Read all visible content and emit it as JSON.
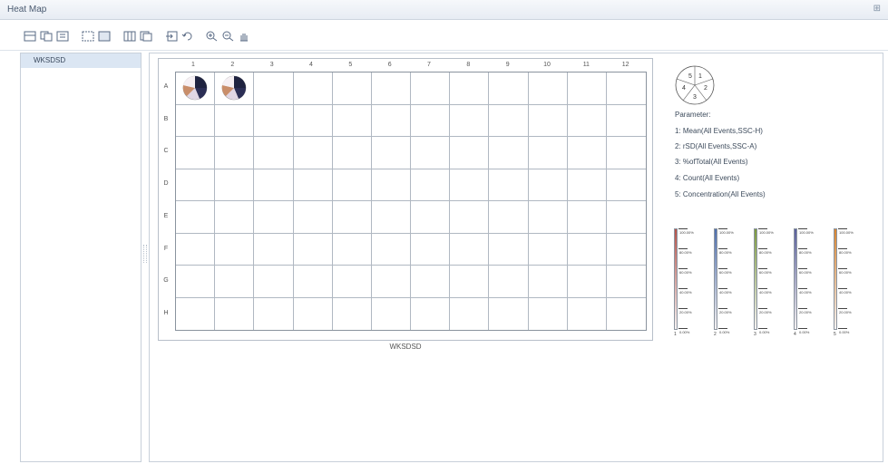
{
  "window": {
    "title": "Heat Map",
    "pin_glyph": "⊞"
  },
  "toolbar": {
    "buttons": [
      "layout-icon",
      "copy-icon",
      "export-icon",
      "select-icon",
      "select-all-icon",
      "grid-icon",
      "copy-plate-icon",
      "import-icon",
      "undo-icon",
      "zoom-in-icon",
      "zoom-out-icon",
      "pan-icon"
    ]
  },
  "sidebar": {
    "items": [
      {
        "label": "WKSDSD"
      }
    ]
  },
  "plate": {
    "columns": [
      "1",
      "2",
      "3",
      "4",
      "5",
      "6",
      "7",
      "8",
      "9",
      "10",
      "11",
      "12"
    ],
    "rows": [
      "A",
      "B",
      "C",
      "D",
      "E",
      "F",
      "G",
      "H"
    ],
    "caption": "WKSDSD",
    "filled_wells": [
      "A1",
      "A2"
    ]
  },
  "legend": {
    "segment_numbers": [
      "5",
      "1",
      "4",
      "2",
      "3"
    ],
    "parameters_title": "Parameter:",
    "parameters": [
      "1: Mean(All Events,SSC-H)",
      "2: rSD(All Events,SSC-A)",
      "3: %ofTotal(All Events)",
      "4: Count(All Events)",
      "5: Concentration(All Events)"
    ]
  },
  "scales": [
    {
      "number": "1",
      "color": "#b5534a",
      "labels": [
        "100.00%",
        "80.00%",
        "60.00%",
        "40.00%",
        "20.00%",
        "0.00%"
      ]
    },
    {
      "number": "2",
      "color": "#4e6fae",
      "labels": [
        "100.00%",
        "80.00%",
        "60.00%",
        "40.00%",
        "20.00%",
        "0.00%"
      ]
    },
    {
      "number": "3",
      "color": "#7d9a3e",
      "labels": [
        "100.00%",
        "80.00%",
        "60.00%",
        "40.00%",
        "20.00%",
        "0.00%"
      ]
    },
    {
      "number": "4",
      "color": "#5a5f9c",
      "labels": [
        "100.00%",
        "80.00%",
        "60.00%",
        "40.00%",
        "20.00%",
        "0.00%"
      ]
    },
    {
      "number": "5",
      "color": "#d9842e",
      "labels": [
        "100.00%",
        "80.00%",
        "60.00%",
        "40.00%",
        "20.00%",
        "0.00%"
      ]
    }
  ]
}
